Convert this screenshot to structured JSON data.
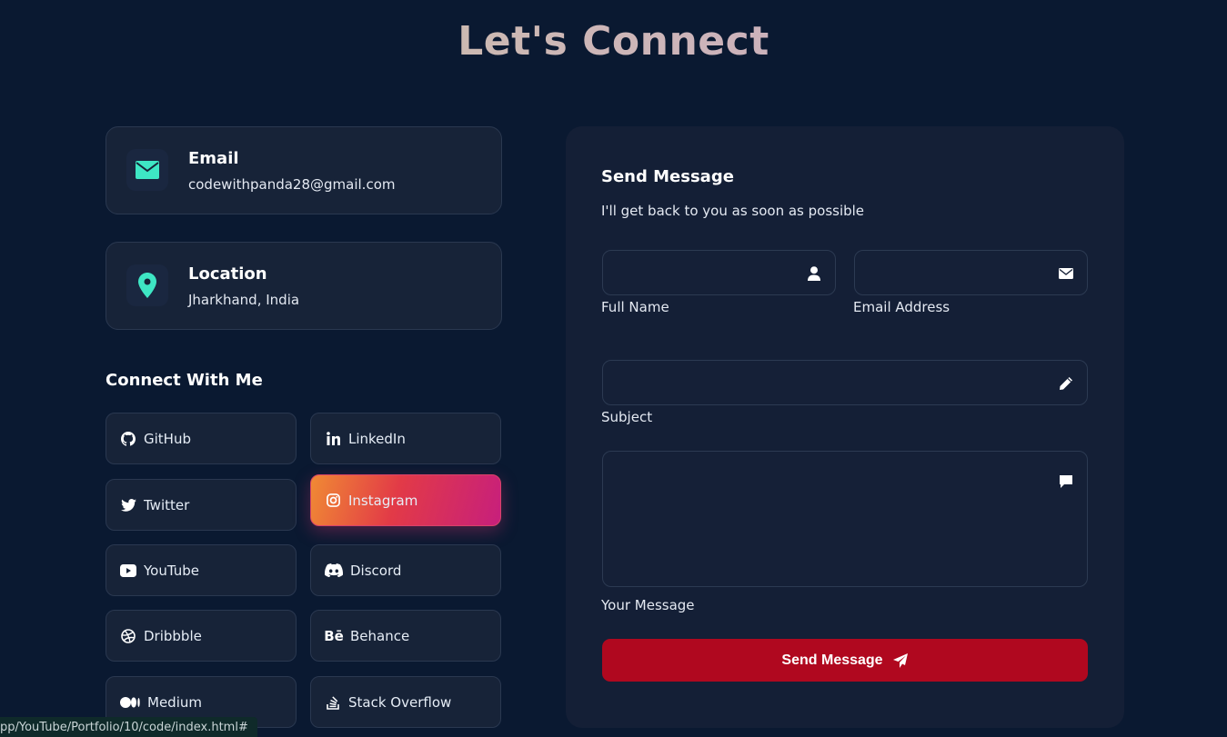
{
  "page": {
    "title": "Let's Connect"
  },
  "contact_cards": [
    {
      "title": "Email",
      "value": "codewithpanda28@gmail.com",
      "icon": "envelope-icon"
    },
    {
      "title": "Location",
      "value": "Jharkhand, India",
      "icon": "map-pin-icon"
    }
  ],
  "social": {
    "heading": "Connect With Me",
    "links": [
      {
        "label": "GitHub",
        "icon": "github-icon"
      },
      {
        "label": "LinkedIn",
        "icon": "linkedin-icon"
      },
      {
        "label": "Twitter",
        "icon": "twitter-icon"
      },
      {
        "label": "Instagram",
        "icon": "instagram-icon",
        "active": true
      },
      {
        "label": "YouTube",
        "icon": "youtube-icon"
      },
      {
        "label": "Discord",
        "icon": "discord-icon"
      },
      {
        "label": "Dribbble",
        "icon": "dribbble-icon"
      },
      {
        "label": "Behance",
        "icon": "behance-icon"
      },
      {
        "label": "Medium",
        "icon": "medium-icon"
      },
      {
        "label": "Stack Overflow",
        "icon": "stackoverflow-icon"
      }
    ]
  },
  "form": {
    "title": "Send Message",
    "subtitle": "I'll get back to you as soon as possible",
    "full_name": {
      "label": "Full Name",
      "value": "",
      "icon": "user-icon"
    },
    "email": {
      "label": "Email Address",
      "value": "",
      "icon": "envelope-icon"
    },
    "subject": {
      "label": "Subject",
      "value": "",
      "icon": "pencil-icon"
    },
    "message": {
      "label": "Your Message",
      "value": "",
      "icon": "comment-icon"
    },
    "submit_label": "Send Message",
    "submit_icon": "paper-plane-icon"
  },
  "status_bar": {
    "url": "pp/YouTube/Portfolio/10/code/index.html#"
  },
  "colors": {
    "background": "#0a1931",
    "card": "#172338",
    "accent_icon": "#3ee6c4",
    "submit": "#b0081f"
  }
}
